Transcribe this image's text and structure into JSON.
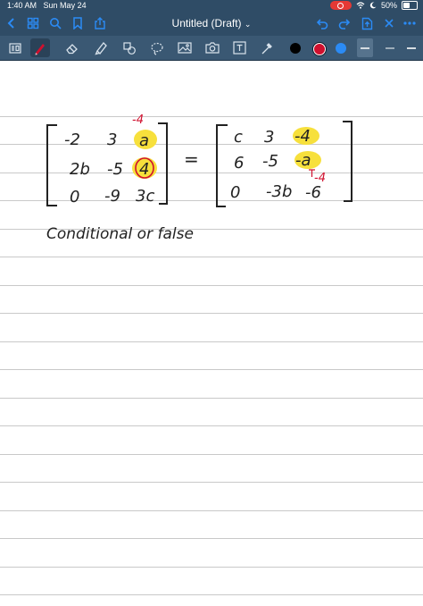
{
  "status_bar": {
    "time": "1:40 AM",
    "date": "Sun May 24",
    "battery": "50%",
    "battery_level": 0.5
  },
  "document": {
    "title": "Untitled (Draft)"
  },
  "nav_icons": {
    "left": [
      "back-chevron-icon",
      "thumbnails-grid-icon",
      "search-icon",
      "bookmark-icon",
      "share-icon"
    ],
    "right": [
      "undo-icon",
      "redo-icon",
      "export-icon",
      "close-icon",
      "more-icon"
    ]
  },
  "tools": [
    "read-mode-icon",
    "pen-icon",
    "eraser-icon",
    "highlighter-icon",
    "shapes-icon",
    "lasso-icon",
    "image-icon",
    "camera-icon",
    "text-box-icon",
    "laser-pointer-icon"
  ],
  "colors": {
    "top_bar": "#2f4c66",
    "toolbar": "#3a5873",
    "accent": "#2b8bf5",
    "ink": "#222222",
    "annotation": "#d0102e",
    "highlight": "#f7e03c",
    "swatches": [
      "#000000",
      "#d0102e",
      "#2b8bf5"
    ]
  },
  "handwriting": {
    "left_matrix": [
      [
        "-2",
        "3",
        "a"
      ],
      [
        "2b",
        "-5",
        "4"
      ],
      [
        "0",
        "-9",
        "3c"
      ]
    ],
    "right_matrix": [
      [
        "c",
        "3",
        "-4"
      ],
      [
        "6",
        "-5",
        "-a"
      ],
      [
        "0",
        "-3b",
        "-6"
      ]
    ],
    "equals": "=",
    "annotation_top": "-4",
    "annotation_right": "-4",
    "note": "Conditional or false"
  }
}
